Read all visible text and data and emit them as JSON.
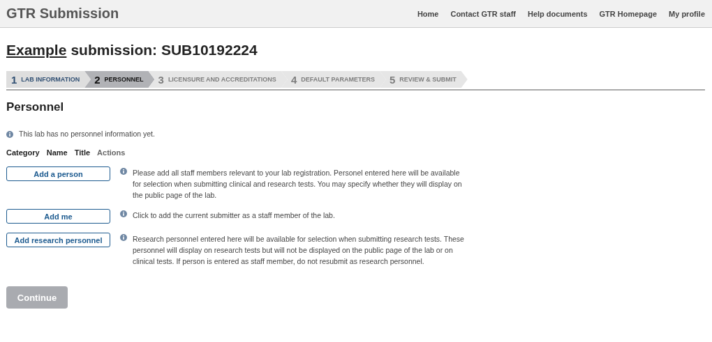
{
  "header": {
    "title": "GTR Submission",
    "nav": [
      "Home",
      "Contact GTR staff",
      "Help documents",
      "GTR Homepage",
      "My profile"
    ]
  },
  "page_title": {
    "link": "Example",
    "text": "submission: SUB10192224"
  },
  "steps": [
    {
      "number": "1",
      "label": "LAB INFORMATION",
      "selected": false,
      "disabled": false
    },
    {
      "number": "2",
      "label": "PERSONNEL",
      "selected": true,
      "disabled": false
    },
    {
      "number": "3",
      "label": "LICENSURE AND ACCREDITATIONS",
      "selected": false,
      "disabled": true
    },
    {
      "number": "4",
      "label": "DEFAULT PARAMETERS",
      "selected": false,
      "disabled": true
    },
    {
      "number": "5",
      "label": "REVIEW & SUBMIT",
      "selected": false,
      "disabled": true
    }
  ],
  "section_title": "Personnel",
  "notice": "This lab has no personnel information yet.",
  "columns": [
    {
      "label": "Category",
      "muted": false
    },
    {
      "label": "Name",
      "muted": false
    },
    {
      "label": "Title",
      "muted": false
    },
    {
      "label": "Actions",
      "muted": true
    }
  ],
  "actions": [
    {
      "button": "Add a person",
      "help": "Please add all staff members relevant to your lab registration. Personel entered here will be available for selection when submitting clinical and research tests. You may specify whether they will display on the public page of the lab."
    },
    {
      "button": "Add me",
      "help": "Click to add the current submitter as a staff member of the lab."
    },
    {
      "button": "Add research personnel",
      "help": "Research personnel entered here will be available for selection when submitting research tests. These personnel will display on research tests but will not be displayed on the public page of the lab or on clinical tests. If person is entered as staff member, do not resubmit as research personnel."
    }
  ],
  "continue_button": {
    "label": "Continue",
    "disabled": true
  }
}
